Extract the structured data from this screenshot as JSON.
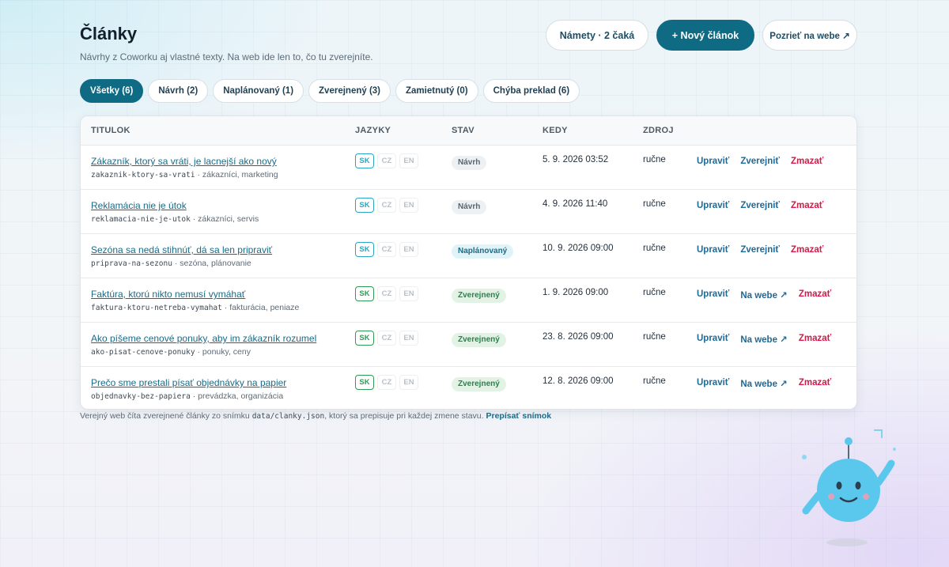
{
  "header": {
    "title": "Články",
    "subtitle": "Návrhy z Coworku aj vlastné texty. Na web ide len to, čo tu zverejníte.",
    "ideas_button": "Námety · 2 čaká",
    "new_button": "+ Nový článok",
    "view_button": "Pozrieť na webe ↗"
  },
  "filters": [
    {
      "label": "Všetky (6)",
      "active": true
    },
    {
      "label": "Návrh (2)",
      "active": false
    },
    {
      "label": "Naplánovaný (1)",
      "active": false
    },
    {
      "label": "Zverejnený (3)",
      "active": false
    },
    {
      "label": "Zamietnutý (0)",
      "active": false
    },
    {
      "label": "Chýba preklad (6)",
      "active": false
    }
  ],
  "table": {
    "columns": {
      "title": "TITULOK",
      "langs": "JAZYKY",
      "status": "STAV",
      "when": "KEDY",
      "source": "ZDROJ"
    },
    "rows": [
      {
        "title": "Zákazník, ktorý sa vráti, je lacnejší ako nový",
        "slug": "zakaznik-ktory-sa-vrati",
        "tags": " · zákazníci, marketing",
        "langs": [
          "SK",
          "CZ",
          "EN"
        ],
        "status": "Návrh",
        "when": "5. 9. 2026 03:52",
        "source": "ručne",
        "actions": [
          "Upraviť",
          "Zverejniť",
          "Zmazať"
        ]
      },
      {
        "title": "Reklamácia nie je útok",
        "slug": "reklamacia-nie-je-utok",
        "tags": " · zákazníci, servis",
        "langs": [
          "SK",
          "CZ",
          "EN"
        ],
        "status": "Návrh",
        "when": "4. 9. 2026 11:40",
        "source": "ručne",
        "actions": [
          "Upraviť",
          "Zverejniť",
          "Zmazať"
        ]
      },
      {
        "title": "Sezóna sa nedá stihnúť, dá sa len pripraviť",
        "slug": "priprava-na-sezonu",
        "tags": " · sezóna, plánovanie",
        "langs": [
          "SK",
          "CZ",
          "EN"
        ],
        "status": "Naplánovaný",
        "when": "10. 9. 2026 09:00",
        "source": "ručne",
        "actions": [
          "Upraviť",
          "Zverejniť",
          "Zmazať"
        ]
      },
      {
        "title": "Faktúra, ktorú nikto nemusí vymáhať",
        "slug": "faktura-ktoru-netreba-vymahat",
        "tags": " · fakturácia, peniaze",
        "langs": [
          "SK",
          "CZ",
          "EN"
        ],
        "status": "Zverejnený",
        "when": "1. 9. 2026 09:00",
        "source": "ručne",
        "actions": [
          "Upraviť",
          "Na webe ↗",
          "Zmazať"
        ]
      },
      {
        "title": "Ako píšeme cenové ponuky, aby im zákazník rozumel",
        "slug": "ako-pisat-cenove-ponuky",
        "tags": " · ponuky, ceny",
        "langs": [
          "SK",
          "CZ",
          "EN"
        ],
        "status": "Zverejnený",
        "when": "23. 8. 2026 09:00",
        "source": "ručne",
        "actions": [
          "Upraviť",
          "Na webe ↗",
          "Zmazať"
        ]
      },
      {
        "title": "Prečo sme prestali písať objednávky na papier",
        "slug": "objednavky-bez-papiera",
        "tags": " · prevádzka, organizácia",
        "langs": [
          "SK",
          "CZ",
          "EN"
        ],
        "status": "Zverejnený",
        "when": "12. 8. 2026 09:00",
        "source": "ručne",
        "actions": [
          "Upraviť",
          "Na webe ↗",
          "Zmazať"
        ]
      }
    ]
  },
  "footnote": {
    "text_before": "Verejný web číta zverejnené články zo snímku ",
    "code": "data/clanky.json",
    "text_after": ", ktorý sa prepisuje pri každej zmene stavu. ",
    "link": "Prepísať snímok"
  },
  "colors": {
    "primary": "#0f6b84",
    "link": "#1c6a86",
    "action_blue": "#1c6a98",
    "danger": "#d11a47",
    "status_draft_bg": "#eef1f3",
    "status_draft_fg": "#5a6670",
    "status_scheduled_bg": "#dff3f8",
    "status_scheduled_fg": "#1a6c86",
    "status_published_bg": "#e2f3e6",
    "status_published_fg": "#26834a",
    "lang_sk_draft": "#2aa6c4",
    "lang_sk_published": "#2f9a53"
  },
  "icons": {
    "mascot": "robot-mascot-icon"
  }
}
